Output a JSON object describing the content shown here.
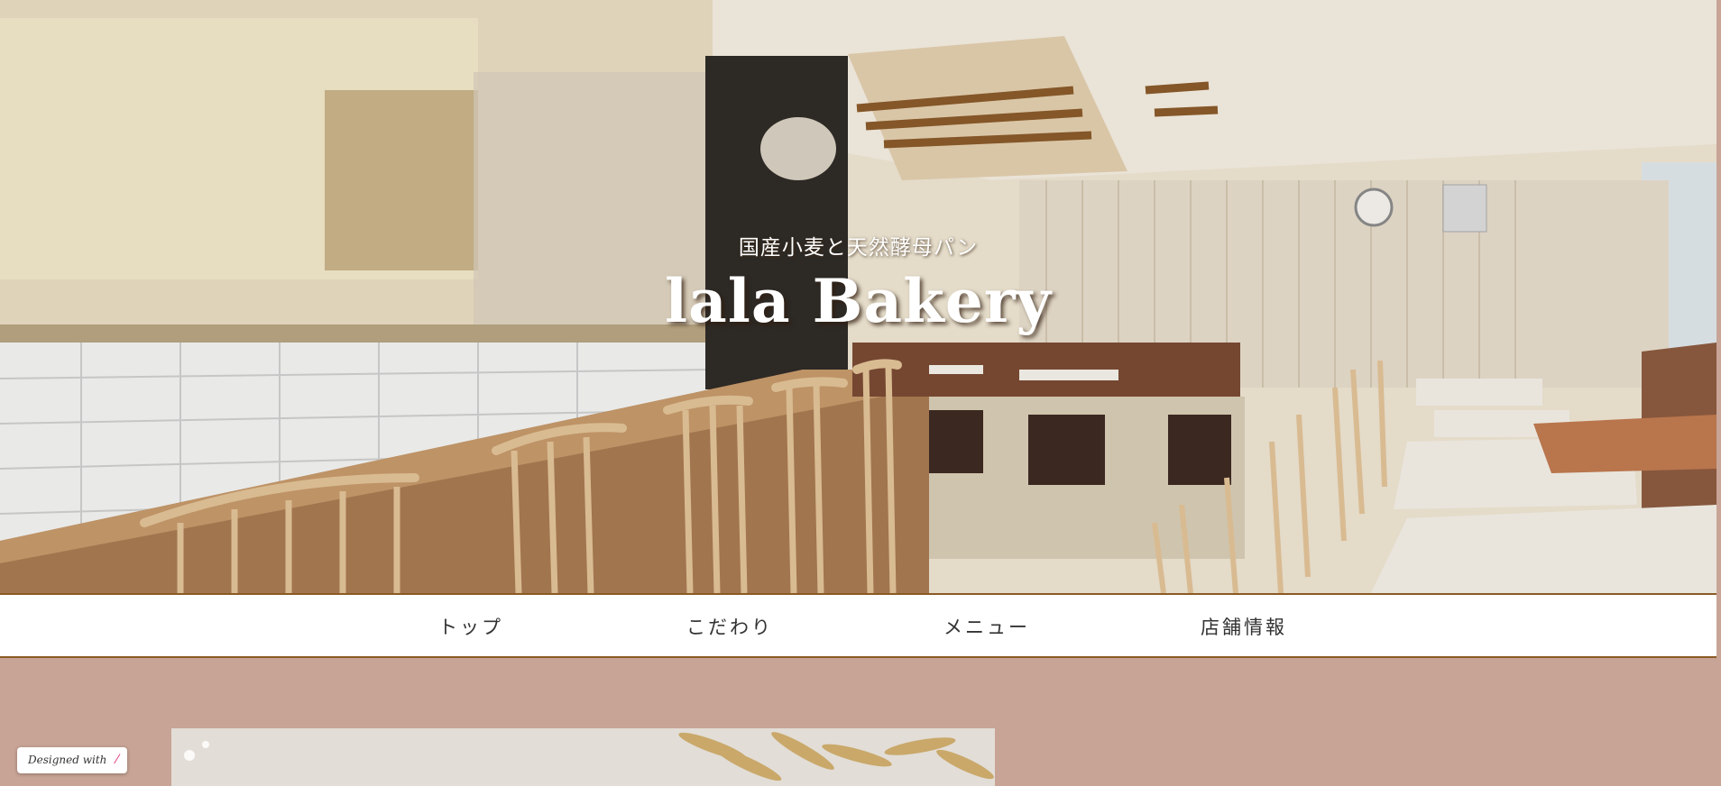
{
  "hero": {
    "subtitle": "国産小麦と天然酵母パン",
    "title": "lala Bakery"
  },
  "nav": {
    "items": [
      {
        "label": "トップ"
      },
      {
        "label": "こだわり"
      },
      {
        "label": "メニュー"
      },
      {
        "label": "店舗情報"
      }
    ]
  },
  "badge": {
    "label": "Designed with",
    "icon": "pen-icon"
  },
  "colors": {
    "nav_border": "#8a5a24",
    "content_bg": "#c8a496",
    "nav_bg": "#ffffff"
  }
}
